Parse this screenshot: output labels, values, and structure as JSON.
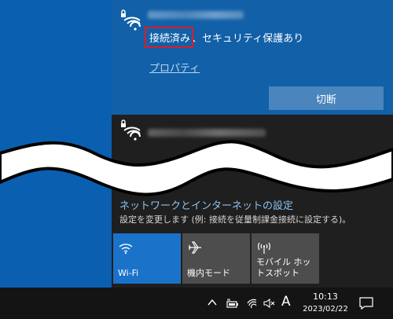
{
  "active_network": {
    "status_highlight": "接続済み",
    "status_rest": "、セキュリティ保護あり",
    "properties_link": "プロパティ",
    "disconnect_button": "切断"
  },
  "network_settings": {
    "title": "ネットワークとインターネットの設定",
    "description": "設定を変更します (例: 接続を従量制課金接続に設定する)。"
  },
  "quick_actions": [
    {
      "label": "Wi-Fi",
      "active": true,
      "icon": "wifi-icon"
    },
    {
      "label": "機内モード",
      "active": false,
      "icon": "airplane-icon"
    },
    {
      "label": "モバイル ホットスポット",
      "active": false,
      "icon": "hotspot-icon"
    }
  ],
  "taskbar": {
    "ime_indicator": "A",
    "time": "10:13",
    "date": "2023/02/22"
  },
  "colors": {
    "active_network_bg": "#1160a8",
    "flyout_bg": "#1f1f1f",
    "highlight_box": "#e01b24",
    "settings_link": "#8cc3f3",
    "wifi_tile_active": "#1a73c9"
  }
}
